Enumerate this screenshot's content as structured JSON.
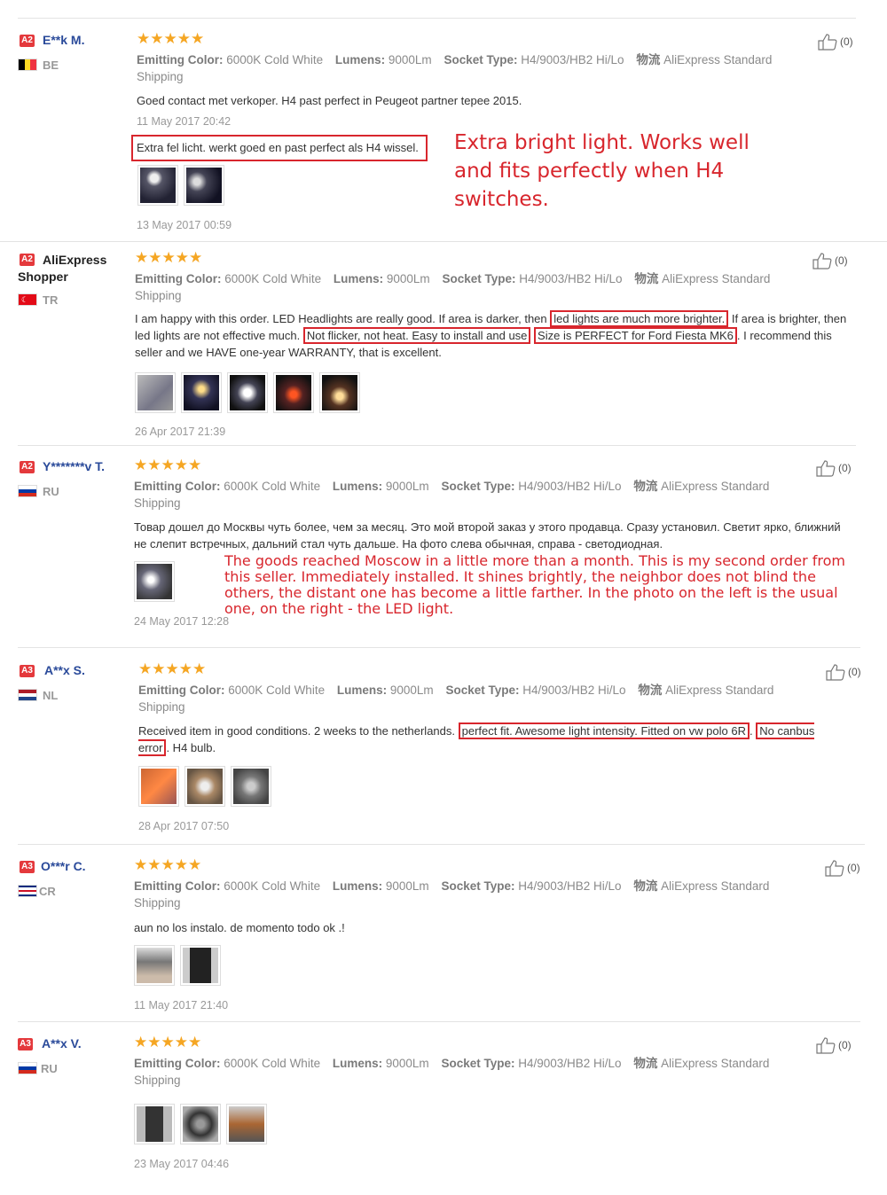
{
  "common": {
    "attr_emitting_label": "Emitting Color:",
    "attr_emitting_value": "6000K Cold White",
    "attr_lumens_label": "Lumens:",
    "attr_lumens_value": "9000Lm",
    "attr_socket_label": "Socket Type:",
    "attr_socket_value": "H4/9003/HB2 Hi/Lo",
    "shipping_label": "物流",
    "shipping_value": "AliExpress Standard",
    "shipping_tail": "Shipping",
    "stars": "★★★★★",
    "like_count": "(0)"
  },
  "reviews": [
    {
      "level": "A2",
      "name": "E**k M.",
      "country": "BE",
      "text": "Goed contact met verkoper. H4 past perfect in Peugeot partner tepee 2015.",
      "date1": "11 May 2017 20:42",
      "followup": "Extra fel licht. werkt goed en past perfect als H4 wissel.",
      "translation": "Extra bright light. Works well and fits perfectly when H4 switches.",
      "date2": "13 May 2017 00:59"
    },
    {
      "level": "A2",
      "name": "AliExpress Shopper",
      "country": "TR",
      "text_parts": [
        "I am happy with this order. LED Headlights are really good. If area is darker, then",
        "led lights are much more brighter.",
        "If area is brighter, then led lights are not effective much.",
        "Not flicker, not heat. Easy to install and use",
        "Size is PERFECT for Ford Fiesta MK6",
        ". I recommend this seller and we HAVE one-year WARRANTY, that is excellent."
      ],
      "date": "26 Apr 2017 21:39"
    },
    {
      "level": "A2",
      "name": "Y*******v T.",
      "country": "RU",
      "text": "Товар дошел до Москвы чуть более, чем за месяц. Это мой второй заказ у этого продавца. Сразу установил. Светит ярко, ближний не слепит встречных, дальний стал чуть дальше. На фото слева обычная, справа - светодиодная.",
      "translation": "The goods reached Moscow in a little more than a month. This is my second order from this seller. Immediately installed. It shines brightly, the neighbor does not blind the others, the distant one has become a little farther. In the photo on the left is the usual one, on the right - the LED light.",
      "date": "24 May 2017 12:28"
    },
    {
      "level": "A3",
      "name": "A**x S.",
      "country": "NL",
      "text_parts": [
        "Received item in good conditions. 2 weeks to the netherlands.",
        "perfect fit. Awesome light intensity. Fitted on vw polo 6R",
        ".",
        "No canbus error",
        ". H4 bulb."
      ],
      "date": "28 Apr 2017 07:50"
    },
    {
      "level": "A3",
      "name": "O***r C.",
      "country": "CR",
      "text": "aun no los instalo. de momento todo ok .!",
      "date": "11 May 2017 21:40"
    },
    {
      "level": "A3",
      "name": "A**x V.",
      "country": "RU",
      "text": "",
      "date": "23 May 2017 04:46"
    }
  ]
}
